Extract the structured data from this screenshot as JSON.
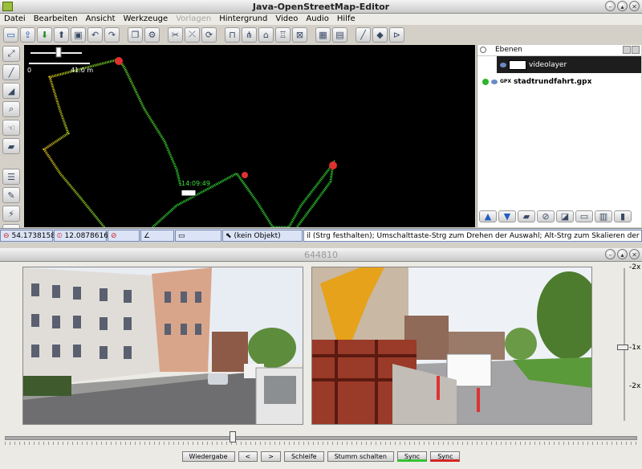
{
  "main_window": {
    "title": "Java-OpenStreetMap-Editor",
    "menus": [
      "Datei",
      "Bearbeiten",
      "Ansicht",
      "Werkzeuge",
      "Vorlagen",
      "Hintergrund",
      "Video",
      "Audio",
      "Hilfe"
    ],
    "disabled_menus": [
      "Vorlagen"
    ]
  },
  "map": {
    "scale_zero": "0",
    "scale_label": "41.0 m",
    "time_label": "14:09:49"
  },
  "layers_panel": {
    "title": "Ebenen",
    "layers": [
      {
        "name": "videolayer",
        "selected": true
      },
      {
        "name": "stadtrundfahrt.gpx",
        "selected": false
      }
    ]
  },
  "status": {
    "lat": "54.1738158",
    "lon": "12.0878616",
    "object": "(kein Objekt)",
    "message": "il (Strg festhalten); Umschalttaste-Strg zum Drehen der Auswahl; Alt-Strg zum Skalieren der Auswahl; oder Auswahl ändern"
  },
  "player_window": {
    "title": "644810",
    "speed_labels": [
      "-2x",
      "-1x",
      "-2x"
    ],
    "buttons": {
      "play": "Wiedergabe",
      "prev": "<",
      "next": ">",
      "loop": "Schleife",
      "mute": "Stumm schalten",
      "sync_green": "Sync",
      "sync_red": "Sync"
    },
    "colors": {
      "sync_green": "#34c234",
      "sync_red": "#d42424"
    }
  }
}
